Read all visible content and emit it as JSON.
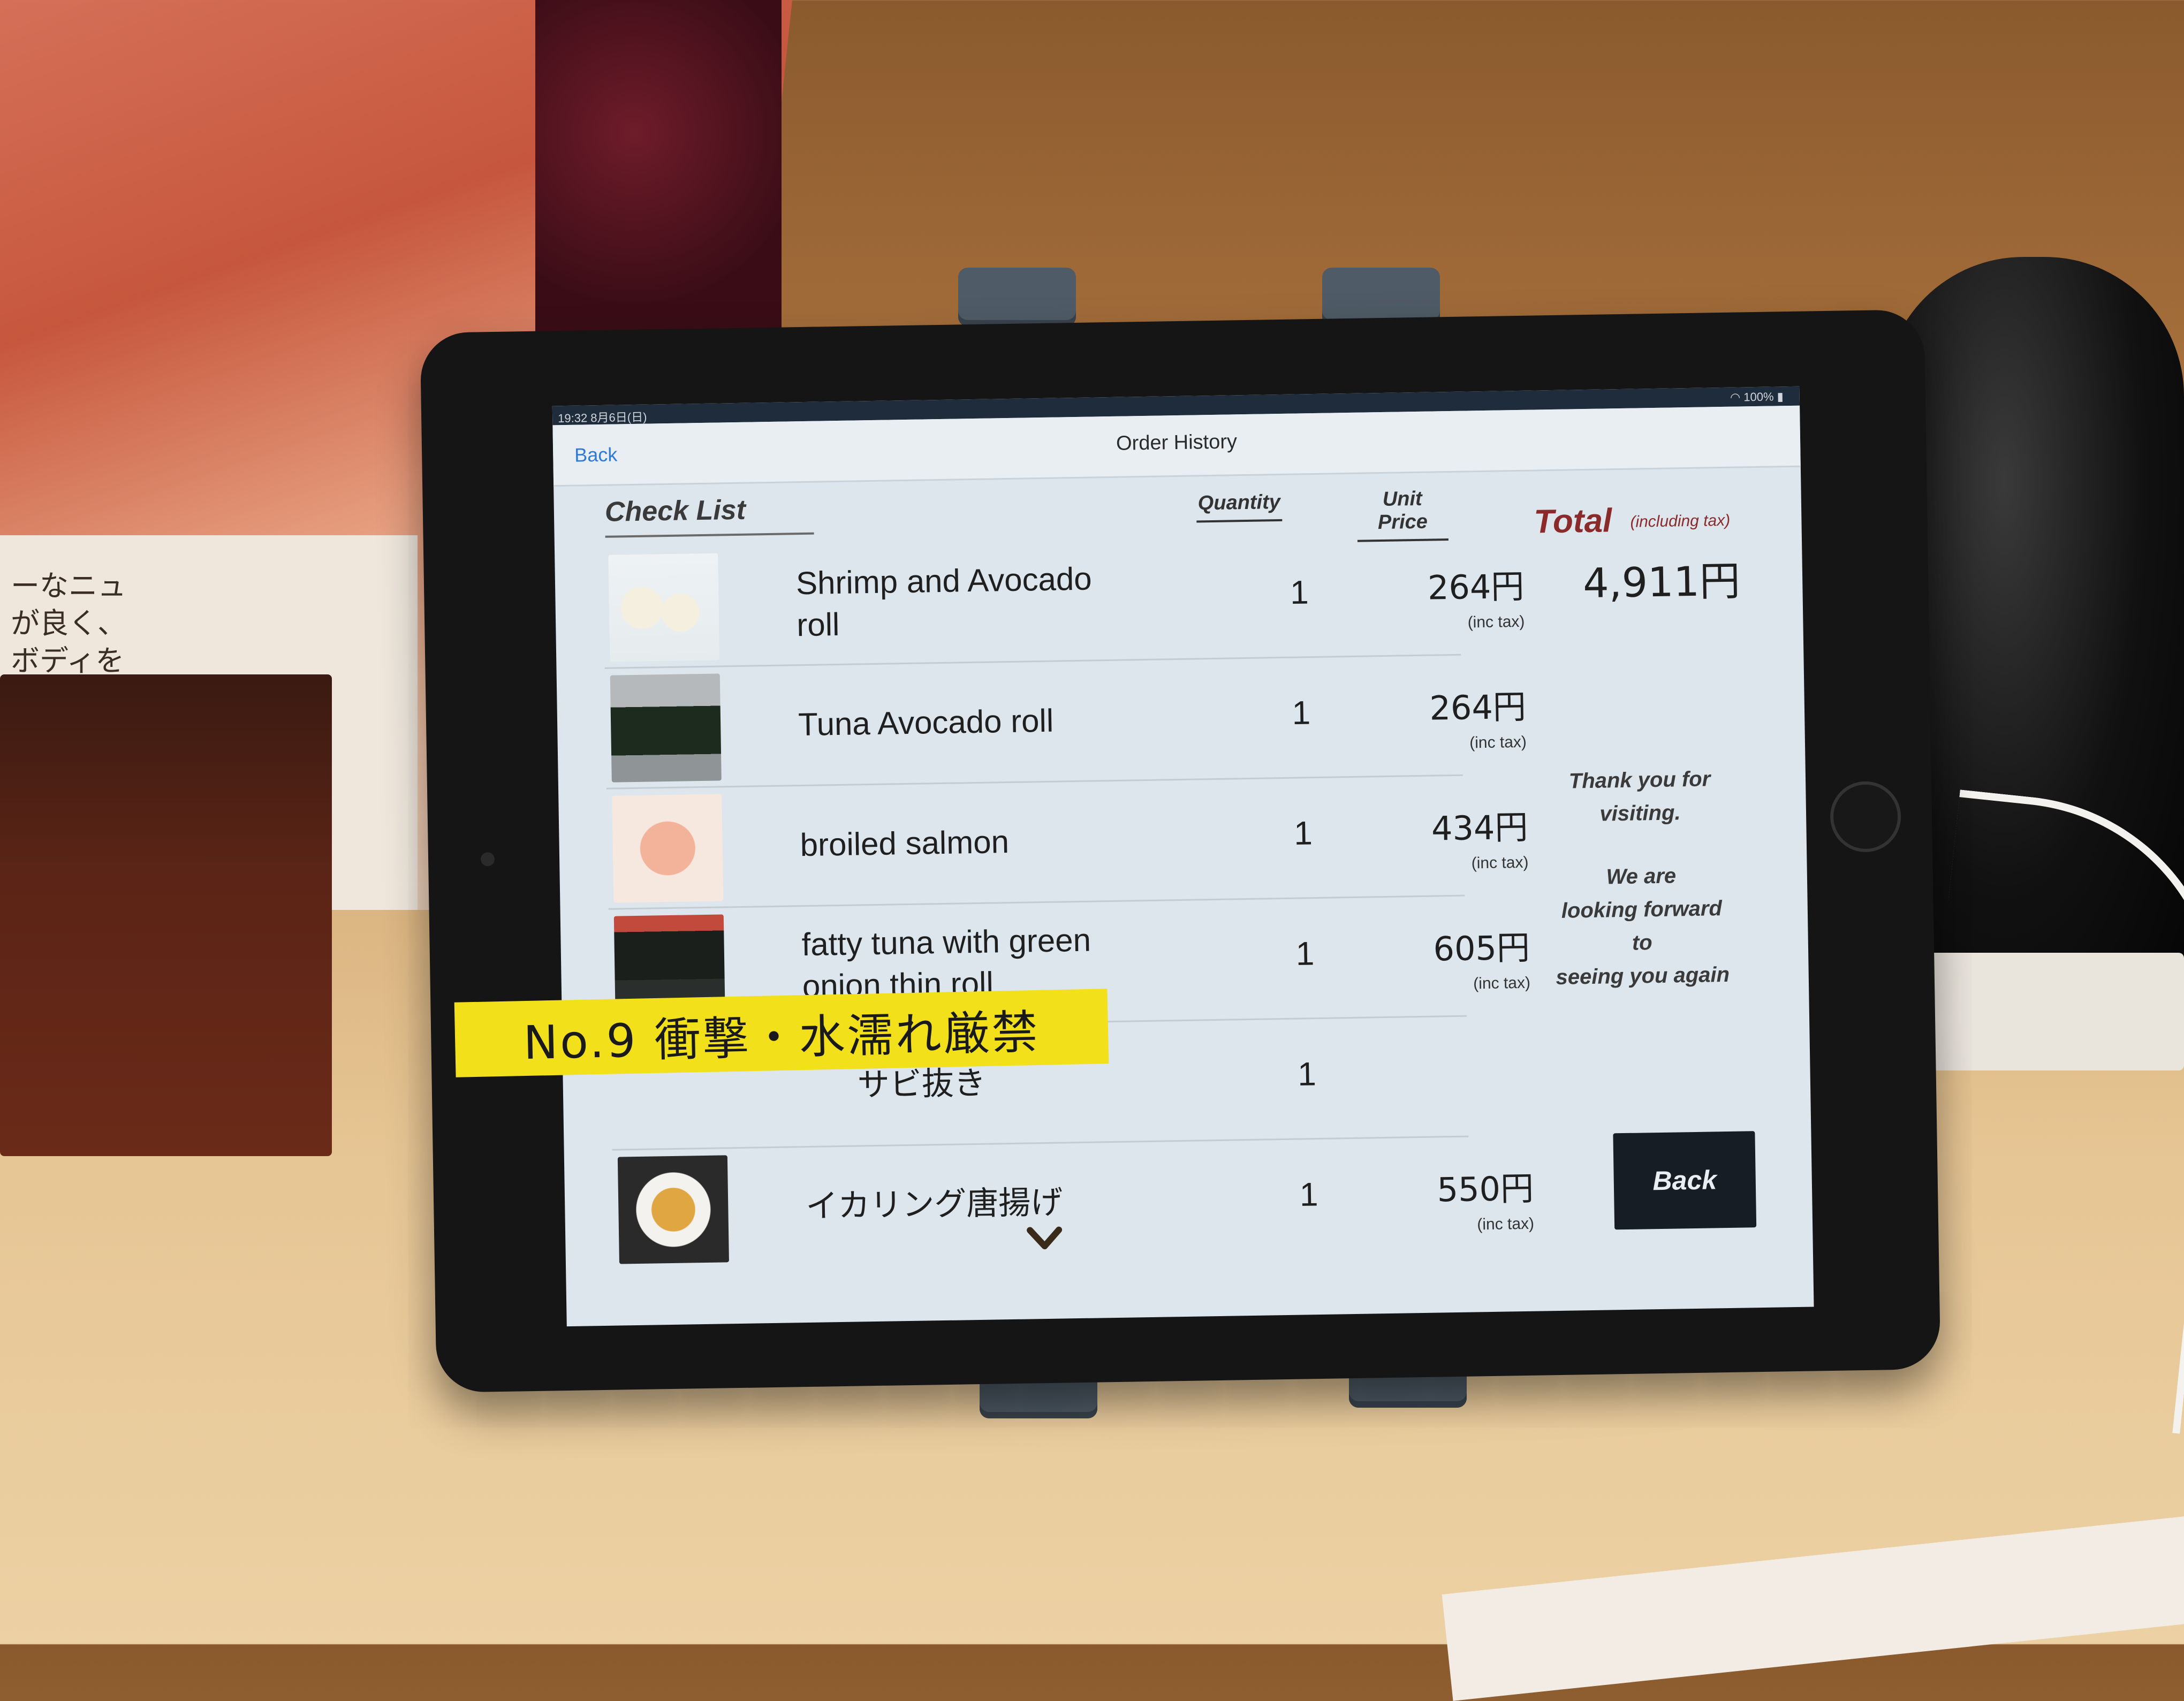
{
  "background": {
    "menu_text": "ーなニュ\nが良く、\nボディを"
  },
  "status_bar": {
    "time": "19:32  8月6日(日)",
    "battery": "100%"
  },
  "nav": {
    "back_label": "Back",
    "title": "Order History"
  },
  "list": {
    "title": "Check List",
    "col_quantity": "Quantity",
    "col_unit_price": "Unit Price",
    "items": [
      {
        "name": "Shrimp and Avocado roll",
        "quantity": "1",
        "price": "264円",
        "tax": "(inc tax)"
      },
      {
        "name": "Tuna Avocado roll",
        "quantity": "1",
        "price": "264円",
        "tax": "(inc tax)"
      },
      {
        "name": "broiled salmon",
        "quantity": "1",
        "price": "434円",
        "tax": "(inc tax)"
      },
      {
        "name": "fatty tuna with green onion thin roll",
        "quantity": "1",
        "price": "605円",
        "tax": "(inc tax)"
      },
      {
        "name": "サビ抜き",
        "quantity": "1"
      },
      {
        "name": "イカリング唐揚げ",
        "quantity": "1",
        "price": "550円",
        "tax": "(inc tax)"
      }
    ]
  },
  "total": {
    "label": "Total",
    "note": "(including tax)",
    "value": "4,911円"
  },
  "thanks": {
    "line1": "Thank you for",
    "line2": "visiting.",
    "line3": "We are",
    "line4": "looking forward",
    "line5": "to",
    "line6": "seeing you again"
  },
  "back_button": {
    "label": "Back"
  },
  "sticker": {
    "text": "No.9 衝撃・水濡れ厳禁"
  },
  "colors": {
    "accent_blue": "#2f7ad6",
    "total_red": "#8a2a2a",
    "sticker_yellow": "#f2e01a"
  }
}
